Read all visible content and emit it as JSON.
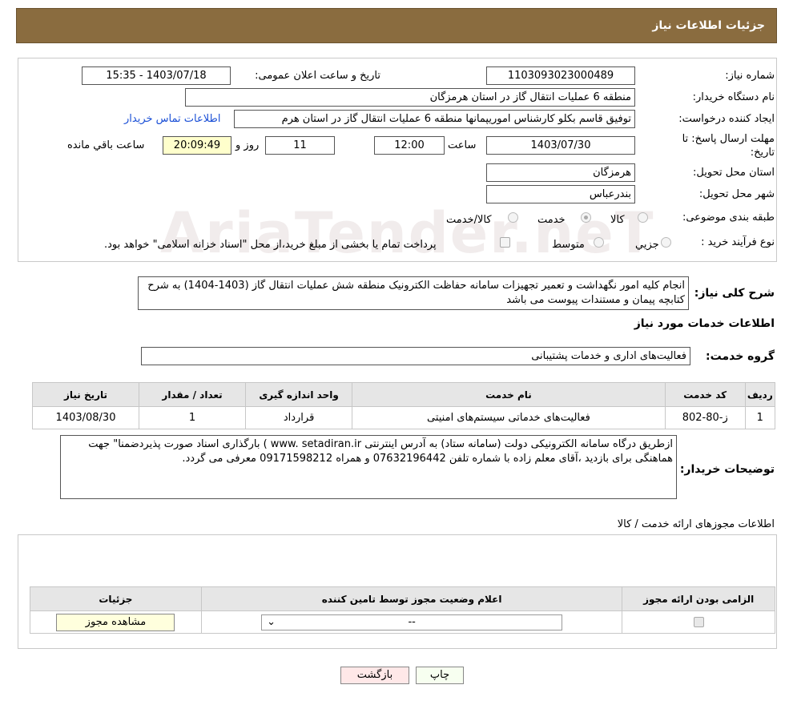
{
  "header": {
    "title": "جزئیات اطلاعات نیاز"
  },
  "need_number": {
    "label": "شماره نیاز:",
    "value": "1103093023000489"
  },
  "announce": {
    "label": "تاریخ و ساعت اعلان عمومی:",
    "value": "1403/07/18 - 15:35"
  },
  "buyer": {
    "label": "نام دستگاه خریدار:",
    "value": "منطقه 6 عملیات انتقال گاز در استان هرمزگان"
  },
  "creator": {
    "label": "ایجاد کننده درخواست:",
    "value": "توفیق قاسم بکلو کارشناس اموریپمانها منطقه 6 عملیات انتقال گاز در استان هرم",
    "contact_link": "اطلاعات تماس خریدار"
  },
  "deadline": {
    "label1": "مهلت ارسال پاسخ: تا",
    "label2": "تاریخ:",
    "date": "1403/07/30",
    "time_label": "ساعت",
    "time": "12:00",
    "days": "11",
    "days_label": "روز و",
    "remaining": "20:09:49",
    "remaining_label": "ساعت باقي مانده"
  },
  "province": {
    "label": "استان محل تحویل:",
    "value": "هرمزگان"
  },
  "city": {
    "label": "شهر محل تحویل:",
    "value": "بندرعباس"
  },
  "category": {
    "label": "طبقه بندی موضوعی:",
    "options": [
      "کالا",
      "خدمت",
      "کالا/خدمت"
    ]
  },
  "process": {
    "label": "نوع فرآیند خرید :",
    "options": [
      "جزيي",
      "متوسط"
    ],
    "note": "پرداخت تمام یا بخشی از مبلغ خرید،از محل \"اسناد خزانه اسلامی\" خواهد بود."
  },
  "description": {
    "label": "شرح کلی نیاز:",
    "value": "انجام کلیه امور  نگهداشت و تعمیر تجهیزات  سامانه حفاظت الکترونیک منطقه شش عملیات انتقال گاز (1403-1404) به شرح کتابچه پیمان و مستندات پیوست  می باشد"
  },
  "services_title": "اطلاعات خدمات مورد نیاز",
  "service_group": {
    "label": "گروه خدمت:",
    "value": "فعالیت‌های اداری و خدمات پشتیبانی"
  },
  "table": {
    "headers": [
      "ردیف",
      "کد خدمت",
      "نام خدمت",
      "واحد اندازه گیری",
      "تعداد / مقدار",
      "تاریخ نیاز"
    ],
    "rows": [
      [
        "1",
        "ز-80-802",
        "فعالیت‌های خدماتی سیستم‌های امنیتی",
        "قرارداد",
        "1",
        "1403/08/30"
      ]
    ]
  },
  "buyer_notes": {
    "label": "توضیحات خریدار:",
    "value": "ازطریق درگاه سامانه الکترونیکی دولت (سامانه ستاد)  به آدرس اینترنتی  www. setadiran.ir  ) بارگذاری اسناد صورت پذیردضمنا\" جهت هماهنگی برای بازدید ،آقای معلم زاده  با شماره تلفن 07632196442 و همراه  09171598212 معرفی  می گردد."
  },
  "permits": {
    "title": "اطلاعات مجوزهای ارائه خدمت / کالا",
    "headers": [
      "الزامی بودن ارائه مجوز",
      "اعلام وضعیت مجوز توسط تامین کننده",
      "جزئیات"
    ],
    "select_value": "--",
    "view_button": "مشاهده مجوز"
  },
  "buttons": {
    "print": "چاپ",
    "back": "بازگشت"
  },
  "watermark": "AriaTender.neT"
}
